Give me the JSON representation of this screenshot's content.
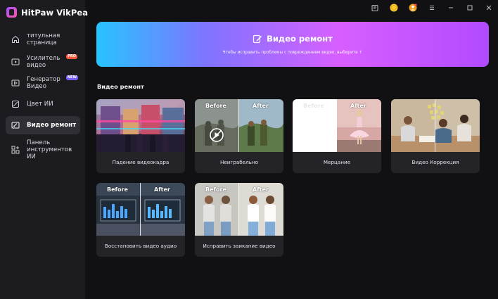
{
  "app": {
    "title": "HitPaw VikPea"
  },
  "sidebar": {
    "items": [
      {
        "label": "титульная страница",
        "icon": "home-icon"
      },
      {
        "label": "Усилитель видео",
        "icon": "video-enhance-icon",
        "badge": "PRO"
      },
      {
        "label": "Генератор Видео",
        "icon": "video-generate-icon",
        "badge": "NEW"
      },
      {
        "label": "Цвет ИИ",
        "icon": "color-icon"
      },
      {
        "label": "Видео ремонт",
        "icon": "repair-icon",
        "active": true
      },
      {
        "label": "Панель инструментов ИИ",
        "icon": "toolbox-icon"
      }
    ]
  },
  "titlebar": {
    "icons": [
      "feedback-icon",
      "coin-icon",
      "account-icon",
      "menu-icon",
      "minimize-icon",
      "maximize-icon",
      "close-icon"
    ]
  },
  "banner": {
    "title": "Видео ремонт",
    "subtitle": "Чтобы исправить проблемы с повреждением видео, выберите ↑",
    "colors": [
      "#27c4ff",
      "#7f74ff",
      "#d75fff",
      "#b14bff"
    ]
  },
  "section": {
    "title": "Видео ремонт"
  },
  "compare": {
    "before": "Before",
    "after": "After"
  },
  "cards": [
    {
      "label": "Падение видеокадра"
    },
    {
      "label": "Неиграбельно"
    },
    {
      "label": "Мерцание"
    },
    {
      "label": "Видео Коррекция"
    },
    {
      "label": "Восстановить видео аудио"
    },
    {
      "label": "Исправить заикание видео"
    }
  ]
}
